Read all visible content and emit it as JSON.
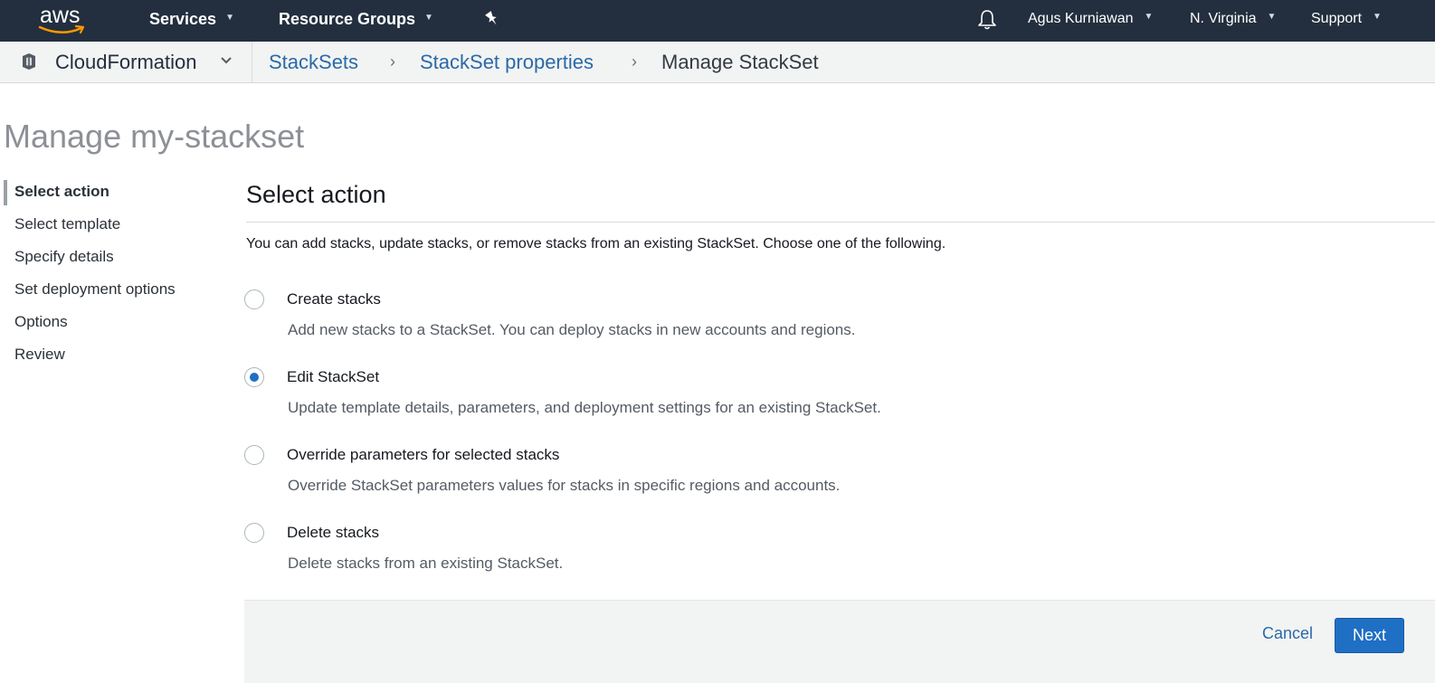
{
  "topnav": {
    "logo_text": "aws",
    "services_label": "Services",
    "resource_groups_label": "Resource Groups",
    "user_label": "Agus Kurniawan",
    "region_label": "N. Virginia",
    "support_label": "Support",
    "background_color": "#232f3e"
  },
  "subnav": {
    "service_label": "CloudFormation",
    "breadcrumbs": [
      {
        "label": "StackSets"
      },
      {
        "label": "StackSet properties"
      },
      {
        "label": "Manage StackSet"
      }
    ],
    "separator": "›"
  },
  "page": {
    "title": "Manage my-stackset"
  },
  "steps": [
    {
      "label": "Select action",
      "active": true
    },
    {
      "label": "Select template"
    },
    {
      "label": "Specify details"
    },
    {
      "label": "Set deployment options"
    },
    {
      "label": "Options"
    },
    {
      "label": "Review"
    }
  ],
  "main": {
    "section_title": "Select action",
    "intro": "You can add stacks, update stacks, or remove stacks from an existing StackSet. Choose one of the following.",
    "options": [
      {
        "label": "Create stacks",
        "description": "Add new stacks to a StackSet. You can deploy stacks in new accounts and regions.",
        "selected": false
      },
      {
        "label": "Edit StackSet",
        "description": "Update template details, parameters, and deployment settings for an existing StackSet.",
        "selected": true
      },
      {
        "label": "Override parameters for selected stacks",
        "description": "Override StackSet parameters values for stacks in specific regions and accounts.",
        "selected": false
      },
      {
        "label": "Delete stacks",
        "description": "Delete stacks from an existing StackSet.",
        "selected": false
      }
    ]
  },
  "footer": {
    "cancel_label": "Cancel",
    "next_label": "Next",
    "primary_color": "#1f6fc4"
  }
}
